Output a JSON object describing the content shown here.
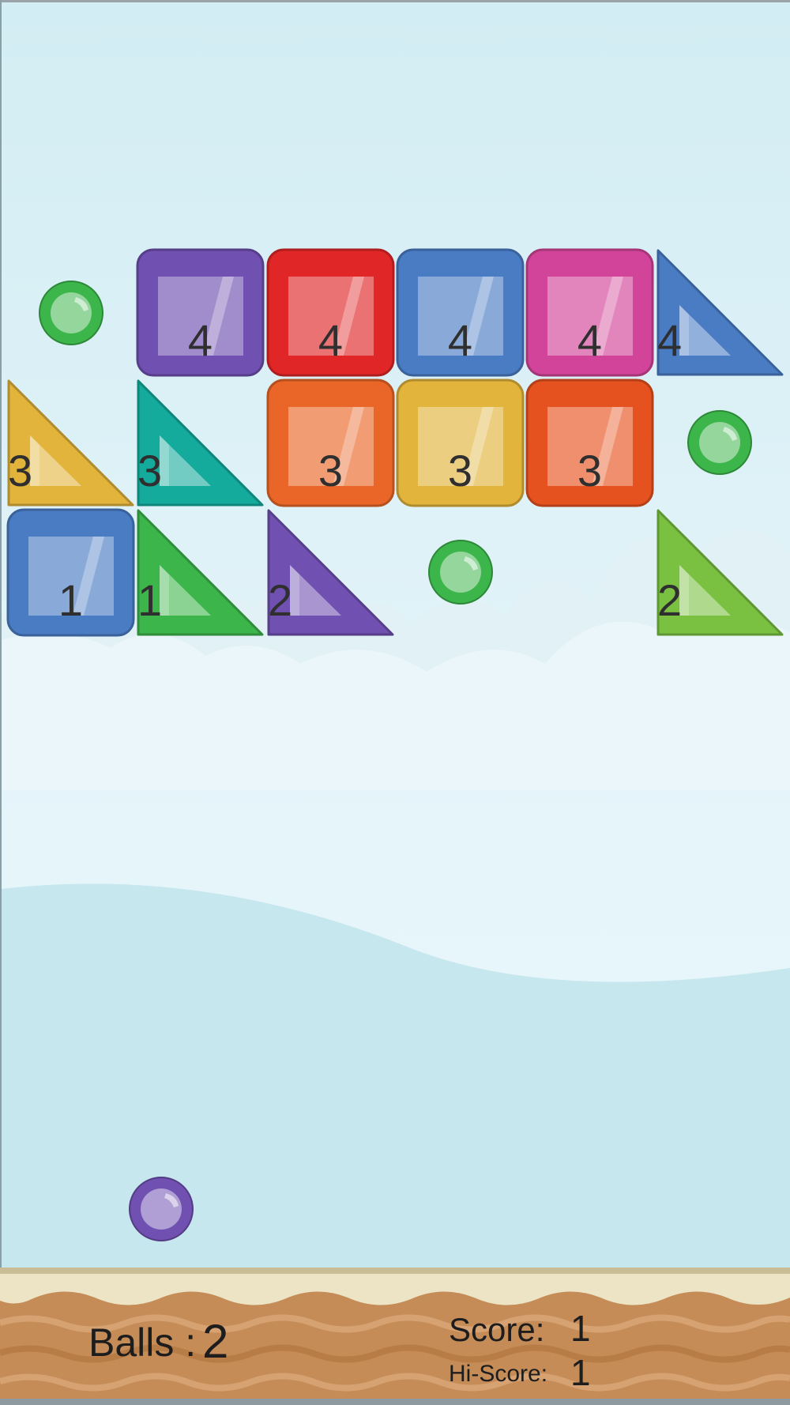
{
  "hud": {
    "balls_label": "Balls :",
    "balls_value": "2",
    "score_label": "Score:",
    "score_value": "1",
    "hiscore_label": "Hi-Score:",
    "hiscore_value": "1"
  },
  "blocks": [
    {
      "shape": "square",
      "color": "purple",
      "hits": "4"
    },
    {
      "shape": "square",
      "color": "red",
      "hits": "4"
    },
    {
      "shape": "square",
      "color": "blue",
      "hits": "4"
    },
    {
      "shape": "square",
      "color": "pink",
      "hits": "4"
    },
    {
      "shape": "triangle",
      "color": "blue",
      "hits": "4"
    },
    {
      "shape": "triangle",
      "color": "yellow",
      "hits": "3"
    },
    {
      "shape": "triangle",
      "color": "teal",
      "hits": "3"
    },
    {
      "shape": "square",
      "color": "orange",
      "hits": "3"
    },
    {
      "shape": "square",
      "color": "yellow",
      "hits": "3"
    },
    {
      "shape": "square",
      "color": "orange-red",
      "hits": "3"
    },
    {
      "shape": "square",
      "color": "blue",
      "hits": "1"
    },
    {
      "shape": "triangle",
      "color": "green",
      "hits": "1"
    },
    {
      "shape": "triangle",
      "color": "purple",
      "hits": "2"
    },
    {
      "shape": "triangle",
      "color": "lime",
      "hits": "2"
    }
  ],
  "pickups": [
    {
      "type": "extra-ball",
      "color": "green"
    },
    {
      "type": "extra-ball",
      "color": "green"
    },
    {
      "type": "extra-ball",
      "color": "green"
    }
  ],
  "launcher_ball": {
    "color": "purple"
  },
  "colors": {
    "purple": "#7050b0",
    "red": "#e02626",
    "blue": "#4a7cc4",
    "pink": "#d24499",
    "yellow": "#e2b43c",
    "teal": "#14aa9c",
    "orange": "#e96628",
    "orange-red": "#e6521f",
    "lime": "#7ac142",
    "green": "#3cb54b",
    "sky": "#d4eef4",
    "sand": "#c58c58"
  }
}
